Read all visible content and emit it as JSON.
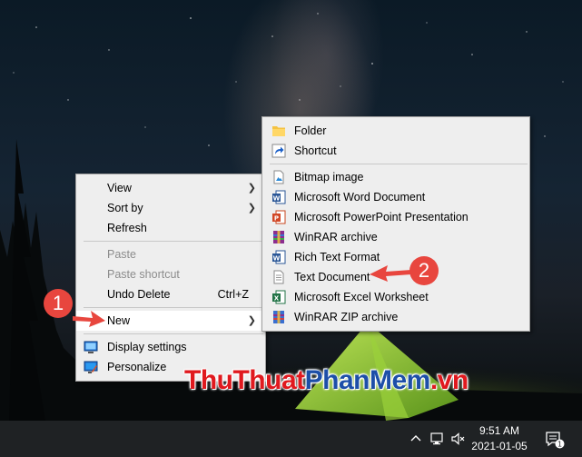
{
  "main_menu": {
    "items": [
      {
        "label": "View",
        "submenu": true
      },
      {
        "label": "Sort by",
        "submenu": true
      },
      {
        "label": "Refresh"
      },
      {
        "label": "Paste",
        "disabled": true
      },
      {
        "label": "Paste shortcut",
        "disabled": true
      },
      {
        "label": "Undo Delete",
        "shortcut": "Ctrl+Z"
      },
      {
        "label": "New",
        "submenu": true,
        "highlighted": true
      },
      {
        "label": "Display settings",
        "icon": "display-settings-icon"
      },
      {
        "label": "Personalize",
        "icon": "personalize-icon"
      }
    ]
  },
  "new_menu": {
    "items": [
      {
        "label": "Folder",
        "icon": "folder-icon"
      },
      {
        "label": "Shortcut",
        "icon": "shortcut-icon"
      },
      {
        "label": "Bitmap image",
        "icon": "bitmap-icon"
      },
      {
        "label": "Microsoft Word Document",
        "icon": "word-icon"
      },
      {
        "label": "Microsoft PowerPoint Presentation",
        "icon": "powerpoint-icon"
      },
      {
        "label": "WinRAR archive",
        "icon": "winrar-icon"
      },
      {
        "label": "Rich Text Format",
        "icon": "rtf-icon"
      },
      {
        "label": "Text Document",
        "icon": "text-document-icon"
      },
      {
        "label": "Microsoft Excel Worksheet",
        "icon": "excel-icon"
      },
      {
        "label": "WinRAR ZIP archive",
        "icon": "winrar-zip-icon"
      }
    ]
  },
  "annotations": {
    "step1": "1",
    "step2": "2"
  },
  "watermark": {
    "part1": "ThuThuat",
    "part2": "PhanMem",
    "part3": ".vn"
  },
  "taskbar": {
    "time": "9:51 AM",
    "date": "2021-01-05",
    "notification_count": "1",
    "tray_icons": [
      "chevron-up-icon",
      "network-icon",
      "volume-muted-icon",
      "notification-icon"
    ]
  },
  "colors": {
    "badge": "#e8463e",
    "menu_bg": "#eeeeee",
    "taskbar_bg": "#1f2224"
  }
}
